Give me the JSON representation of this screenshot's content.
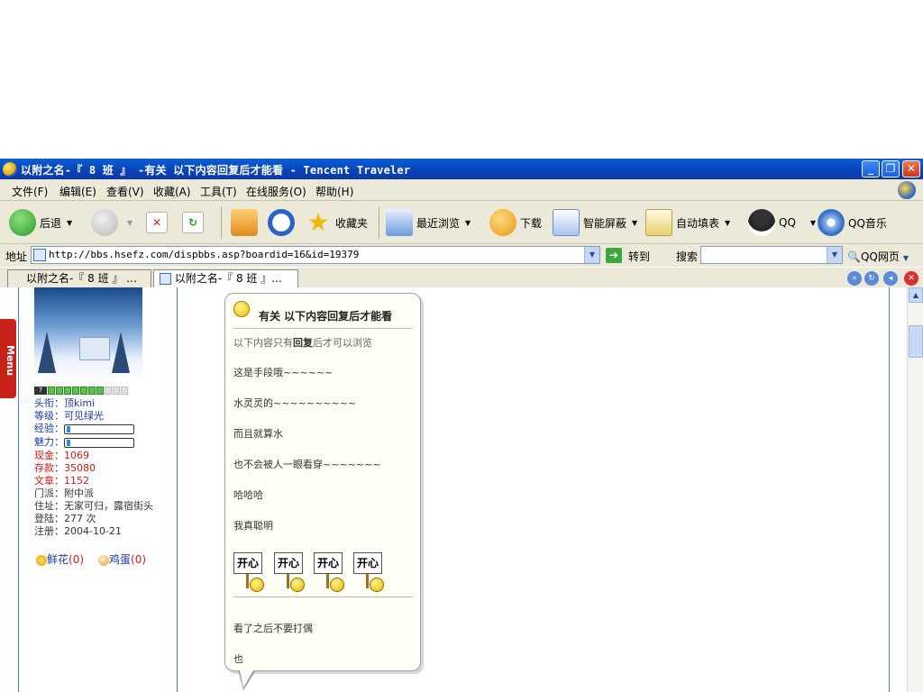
{
  "window": {
    "title": "以附之名-『 8 班 』 -有关 以下内容回复后才能看 - Tencent Traveler"
  },
  "menu": [
    "文件(F)",
    "编辑(E)",
    "查看(V)",
    "收藏(A)",
    "工具(T)",
    "在线服务(O)",
    "帮助(H)"
  ],
  "toolbar": {
    "back": "后退",
    "favorites": "收藏夹",
    "recent": "最近浏览",
    "download": "下载",
    "smart_block": "智能屏蔽",
    "autofill": "自动填表",
    "qq": "QQ",
    "qq_music": "QQ音乐"
  },
  "address": {
    "label": "地址",
    "url": "http://bbs.hsefz.com/dispbbs.asp?boardid=16&id=19379",
    "go": "转到",
    "search_label": "搜索",
    "qq_web": "QQ网页"
  },
  "tabs": [
    "以附之名-『 8 班 』 ...",
    "以附之名-『 8 班 』..."
  ],
  "sidebar": {
    "menu_label": "Menu"
  },
  "profile": {
    "level_num": "7",
    "level_filled": 7,
    "level_total": 10,
    "title_label": "头衔：",
    "title_value": "顶kimi",
    "grade_label": "等级：",
    "grade_value": "可见绿光",
    "exp_label": "经验：",
    "exp_fraction": 0.06,
    "charm_label": "魅力：",
    "charm_fraction": 0.05,
    "gold_label": "现金：",
    "gold_value": "1069",
    "deposit_label": "存款：",
    "deposit_value": "35080",
    "posts_label": "文章：",
    "posts_value": "1152",
    "faction_label": "门派：",
    "faction_value": "附中派",
    "address_label": "住址：",
    "address_value": "无家可归，露宿街头",
    "logins_label": "登陆：",
    "logins_value": "277 次",
    "register_label": "注册：",
    "register_value": "2004-10-21",
    "flowers": "鲜花",
    "flowers_count": "(0)",
    "eggs": "鸡蛋",
    "eggs_count": "(0)"
  },
  "post": {
    "title": "有关  以下内容回复后才能看",
    "note_prefix": "以下内容只有",
    "note_bold": "回复",
    "note_suffix": "后才可以浏览",
    "lines": [
      "这是手段哦~~~~~~",
      "水灵灵的~~~~~~~~~~",
      "而且就算水",
      "也不会被人一眼看穿~~~~~~~",
      "哈哈哈",
      "我真聪明"
    ],
    "emoticon_text": "开心",
    "after_lines": [
      "看了之后不要打偶",
      "也"
    ]
  }
}
